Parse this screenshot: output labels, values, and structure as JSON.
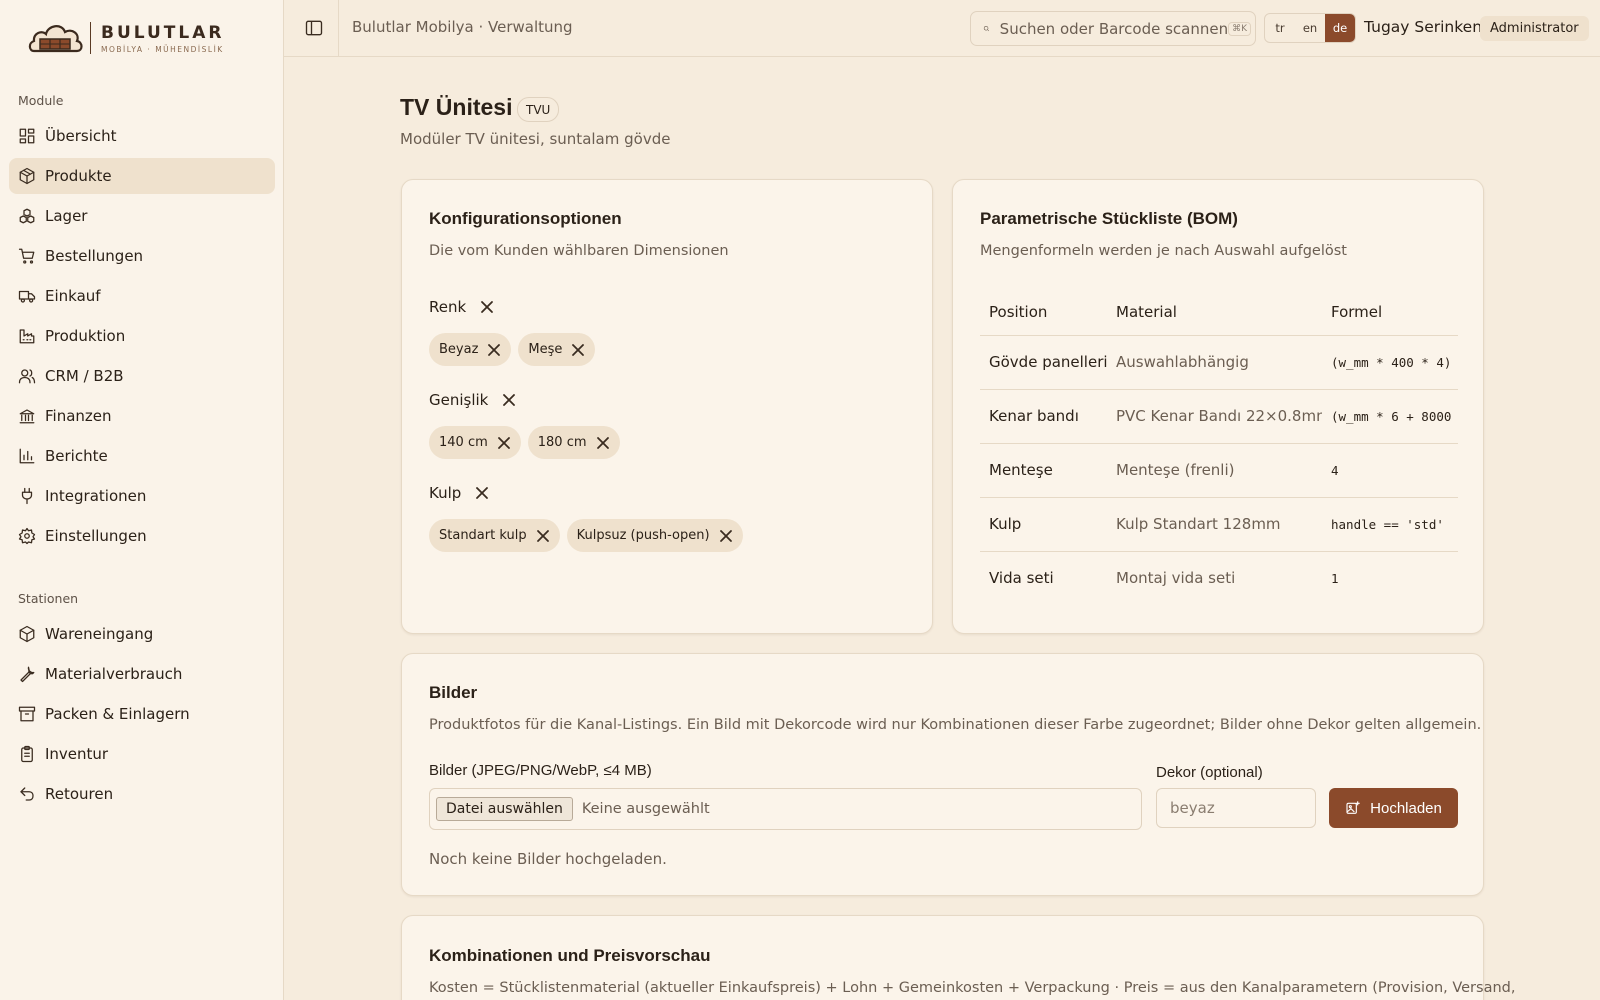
{
  "brand": {
    "name": "BULUTLAR",
    "tagline": "MOBİLYA · MÜHENDİSLİK"
  },
  "sidebar": {
    "modules_label": "Module",
    "modules": [
      {
        "label": "Übersicht",
        "icon": "dashboard-icon"
      },
      {
        "label": "Produkte",
        "icon": "package-icon",
        "active": true
      },
      {
        "label": "Lager",
        "icon": "boxes-icon"
      },
      {
        "label": "Bestellungen",
        "icon": "cart-icon"
      },
      {
        "label": "Einkauf",
        "icon": "truck-icon"
      },
      {
        "label": "Produktion",
        "icon": "factory-icon"
      },
      {
        "label": "CRM / B2B",
        "icon": "users-icon"
      },
      {
        "label": "Finanzen",
        "icon": "bank-icon"
      },
      {
        "label": "Berichte",
        "icon": "bar-chart-icon"
      },
      {
        "label": "Integrationen",
        "icon": "plug-icon"
      },
      {
        "label": "Einstellungen",
        "icon": "gear-icon"
      }
    ],
    "stations_label": "Stationen",
    "stations": [
      {
        "label": "Wareneingang",
        "icon": "package-in-icon"
      },
      {
        "label": "Materialverbrauch",
        "icon": "wrench-icon"
      },
      {
        "label": "Packen & Einlagern",
        "icon": "archive-icon"
      },
      {
        "label": "Inventur",
        "icon": "clipboard-icon"
      },
      {
        "label": "Retouren",
        "icon": "undo-icon"
      }
    ]
  },
  "header": {
    "breadcrumb": "Bulutlar Mobilya · Verwaltung",
    "search_placeholder": "Suchen oder Barcode scannen",
    "search_shortcut": "⌘K",
    "languages": [
      "tr",
      "en",
      "de"
    ],
    "active_language": "de",
    "user_name": "Tugay Serinken",
    "user_role": "Administrator"
  },
  "product": {
    "title": "TV Ünitesi",
    "code": "TVU",
    "subtitle": "Modüler TV ünitesi, suntalam gövde"
  },
  "config": {
    "title": "Konfigurationsoptionen",
    "description": "Die vom Kunden wählbaren Dimensionen",
    "options": [
      {
        "name": "Renk",
        "values": [
          "Beyaz",
          "Meşe"
        ]
      },
      {
        "name": "Genişlik",
        "values": [
          "140 cm",
          "180 cm"
        ]
      },
      {
        "name": "Kulp",
        "values": [
          "Standart kulp",
          "Kulpsuz (push-open)"
        ]
      }
    ]
  },
  "bom": {
    "title": "Parametrische Stückliste (BOM)",
    "description": "Mengenformeln werden je nach Auswahl aufgelöst",
    "columns": [
      "Position",
      "Material",
      "Formel"
    ],
    "rows": [
      [
        "Gövde panelleri",
        "Auswahlabhängig",
        "(w_mm * 400 * 4)"
      ],
      [
        "Kenar bandı",
        "PVC Kenar Bandı 22×0.8mm",
        "(w_mm * 6 + 8000"
      ],
      [
        "Menteşe",
        "Menteşe (frenli)",
        "4"
      ],
      [
        "Kulp",
        "Kulp Standart 128mm",
        "handle == 'std'"
      ],
      [
        "Vida seti",
        "Montaj vida seti",
        "1"
      ]
    ]
  },
  "images": {
    "title": "Bilder",
    "description": "Produktfotos für die Kanal-Listings. Ein Bild mit Dekorcode wird nur Kombinationen dieser Farbe zugeordnet; Bilder ohne Dekor gelten allgemein.",
    "file_label": "Bilder (JPEG/PNG/WebP, ≤4 MB)",
    "file_button": "Datei auswählen",
    "file_none": "Keine ausgewählt",
    "dekor_label": "Dekor (optional)",
    "dekor_placeholder": "beyaz",
    "upload_label": "Hochladen",
    "empty_text": "Noch keine Bilder hochgeladen."
  },
  "combinations": {
    "title": "Kombinationen und Preisvorschau",
    "description": "Kosten = Stücklistenmaterial (aktueller Einkaufspreis) + Lohn + Gemeinkosten + Verpackung · Preis = aus den Kanalparametern (Provision, Versand,"
  },
  "colors": {
    "accent": "#8b4a2b",
    "background": "#f6ecdd",
    "sidebar": "#faf3e9",
    "chip": "#efe1cd"
  }
}
